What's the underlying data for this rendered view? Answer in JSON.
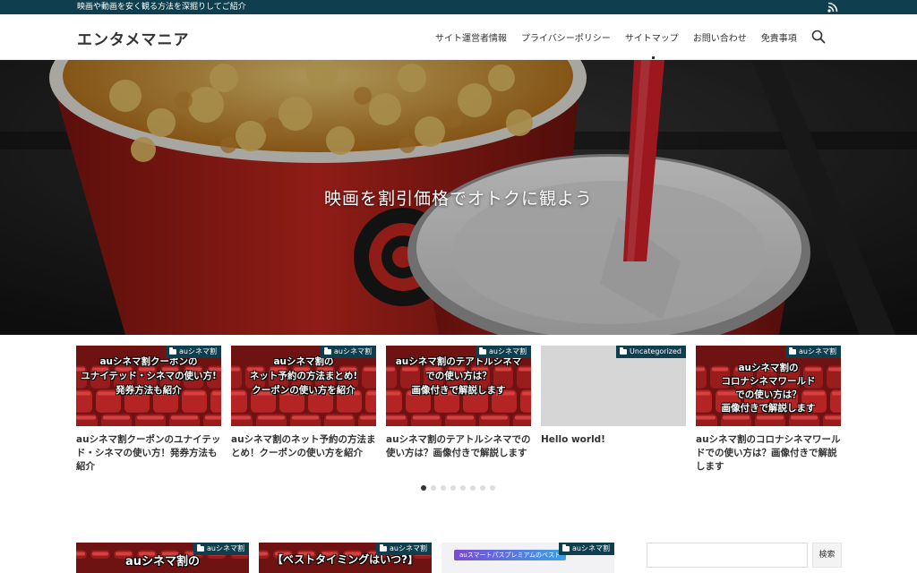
{
  "site": {
    "tagline": "映画や動画を安く観る方法を深掘りしてご紹介",
    "logo": "エンタメマニア"
  },
  "nav": {
    "items": [
      {
        "label": "サイト運営者情報"
      },
      {
        "label": "プライバシーポリシー"
      },
      {
        "label": "サイトマップ"
      },
      {
        "label": "お問い合わせ"
      },
      {
        "label": "免責事項"
      }
    ]
  },
  "icons": {
    "rss": "rss-icon",
    "search": "search-icon",
    "category": "folder-icon"
  },
  "hero": {
    "headline": "映画を割引価格でオトクに観よう"
  },
  "carousel": {
    "cards": [
      {
        "category": "auシネマ割",
        "thumb_lines": [
          "auシネマ割クーポンの",
          "ユナイテッド・シネマの使い方!",
          "発券方法も紹介"
        ],
        "title": "auシネマ割クーポンのユナイテッド・シネマの使い方！発券方法も紹介"
      },
      {
        "category": "auシネマ割",
        "thumb_lines": [
          "auシネマ割の",
          "ネット予約の方法まとめ!",
          "クーポンの使い方を紹介"
        ],
        "title": "auシネマ割のネット予約の方法まとめ！クーポンの使い方を紹介"
      },
      {
        "category": "auシネマ割",
        "thumb_lines": [
          "auシネマ割のテアトルシネマ",
          "での使い方は？",
          "画像付きで解説します"
        ],
        "title": "auシネマ割のテアトルシネマでの使い方は？画像付きで解説します"
      },
      {
        "category": "Uncategorized",
        "thumb_lines": [],
        "title": "Hello world!"
      },
      {
        "category": "auシネマ割",
        "thumb_lines": [
          "auシネマ割の",
          "コロナシネマワールド",
          "での使い方は？",
          "画像付きで解説します"
        ],
        "title": "auシネマ割のコロナシネマワールドでの使い方は？画像付きで解説します"
      }
    ],
    "dots_total": 8,
    "active_dot": 1
  },
  "posts": [
    {
      "category": "auシネマ割",
      "thumb_text": "auシネマ割の"
    },
    {
      "category": "auシネマ割",
      "thumb_text": "【ベストタイミングはいつ?】"
    },
    {
      "category": "auシネマ割",
      "promo_text": "auスマートパスプレミアムのベスト"
    }
  ],
  "sidebar": {
    "search_placeholder": "",
    "search_button": "検索"
  },
  "colors": {
    "topbar": "#0f3f4f",
    "category_badge": "#0f3f4f",
    "seat_red": "#8b1a1a"
  }
}
